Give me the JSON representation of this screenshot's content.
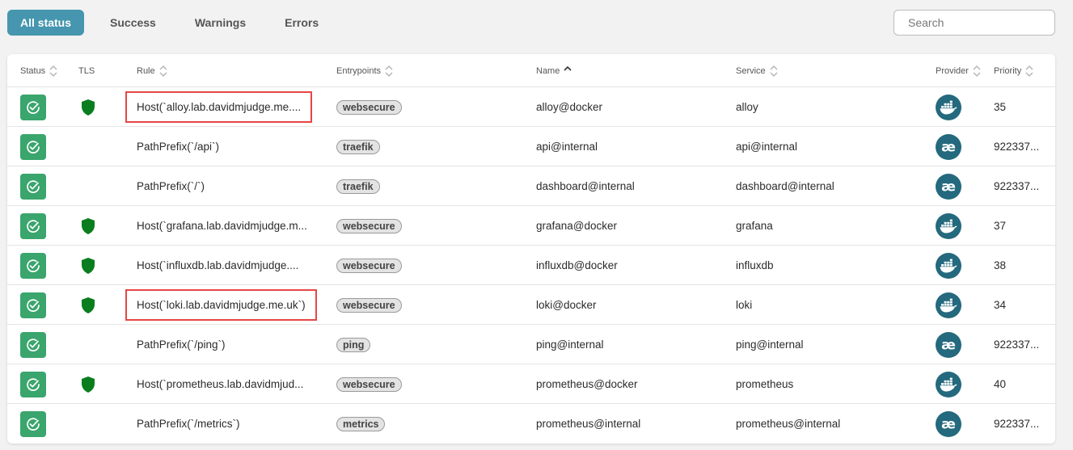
{
  "filters": [
    {
      "label": "All status",
      "active": true
    },
    {
      "label": "Success",
      "active": false
    },
    {
      "label": "Warnings",
      "active": false
    },
    {
      "label": "Errors",
      "active": false
    }
  ],
  "search": {
    "placeholder": "Search"
  },
  "columns": {
    "status": "Status",
    "tls": "TLS",
    "rule": "Rule",
    "entrypoints": "Entrypoints",
    "name": "Name",
    "service": "Service",
    "provider": "Provider",
    "priority": "Priority"
  },
  "colors": {
    "accent": "#4596ae",
    "success": "#3aa56c",
    "tls": "#0a7d1f",
    "provider": "#24697d",
    "highlight": "#e64646"
  },
  "rows": [
    {
      "tls": true,
      "rule": "Host(`alloy.lab.davidmjudge.me....",
      "entrypoint": "websecure",
      "name": "alloy@docker",
      "service": "alloy",
      "provider": "docker",
      "priority": "35",
      "highlighted": true
    },
    {
      "tls": false,
      "rule": "PathPrefix(`/api`)",
      "entrypoint": "traefik",
      "name": "api@internal",
      "service": "api@internal",
      "provider": "internal",
      "priority": "922337..."
    },
    {
      "tls": false,
      "rule": "PathPrefix(`/`)",
      "entrypoint": "traefik",
      "name": "dashboard@internal",
      "service": "dashboard@internal",
      "provider": "internal",
      "priority": "922337..."
    },
    {
      "tls": true,
      "rule": "Host(`grafana.lab.davidmjudge.m...",
      "entrypoint": "websecure",
      "name": "grafana@docker",
      "service": "grafana",
      "provider": "docker",
      "priority": "37"
    },
    {
      "tls": true,
      "rule": "Host(`influxdb.lab.davidmjudge....",
      "entrypoint": "websecure",
      "name": "influxdb@docker",
      "service": "influxdb",
      "provider": "docker",
      "priority": "38"
    },
    {
      "tls": true,
      "rule": "Host(`loki.lab.davidmjudge.me.uk`)",
      "entrypoint": "websecure",
      "name": "loki@docker",
      "service": "loki",
      "provider": "docker",
      "priority": "34",
      "highlighted": true
    },
    {
      "tls": false,
      "rule": "PathPrefix(`/ping`)",
      "entrypoint": "ping",
      "name": "ping@internal",
      "service": "ping@internal",
      "provider": "internal",
      "priority": "922337..."
    },
    {
      "tls": true,
      "rule": "Host(`prometheus.lab.davidmjud...",
      "entrypoint": "websecure",
      "name": "prometheus@docker",
      "service": "prometheus",
      "provider": "docker",
      "priority": "40"
    },
    {
      "tls": false,
      "rule": "PathPrefix(`/metrics`)",
      "entrypoint": "metrics",
      "name": "prometheus@internal",
      "service": "prometheus@internal",
      "provider": "internal",
      "priority": "922337..."
    }
  ],
  "icons": {
    "status": "check-circle-icon",
    "tls": "shield-icon",
    "docker": "docker-icon",
    "internal": "traefik-ae-icon",
    "search": "search-icon"
  }
}
